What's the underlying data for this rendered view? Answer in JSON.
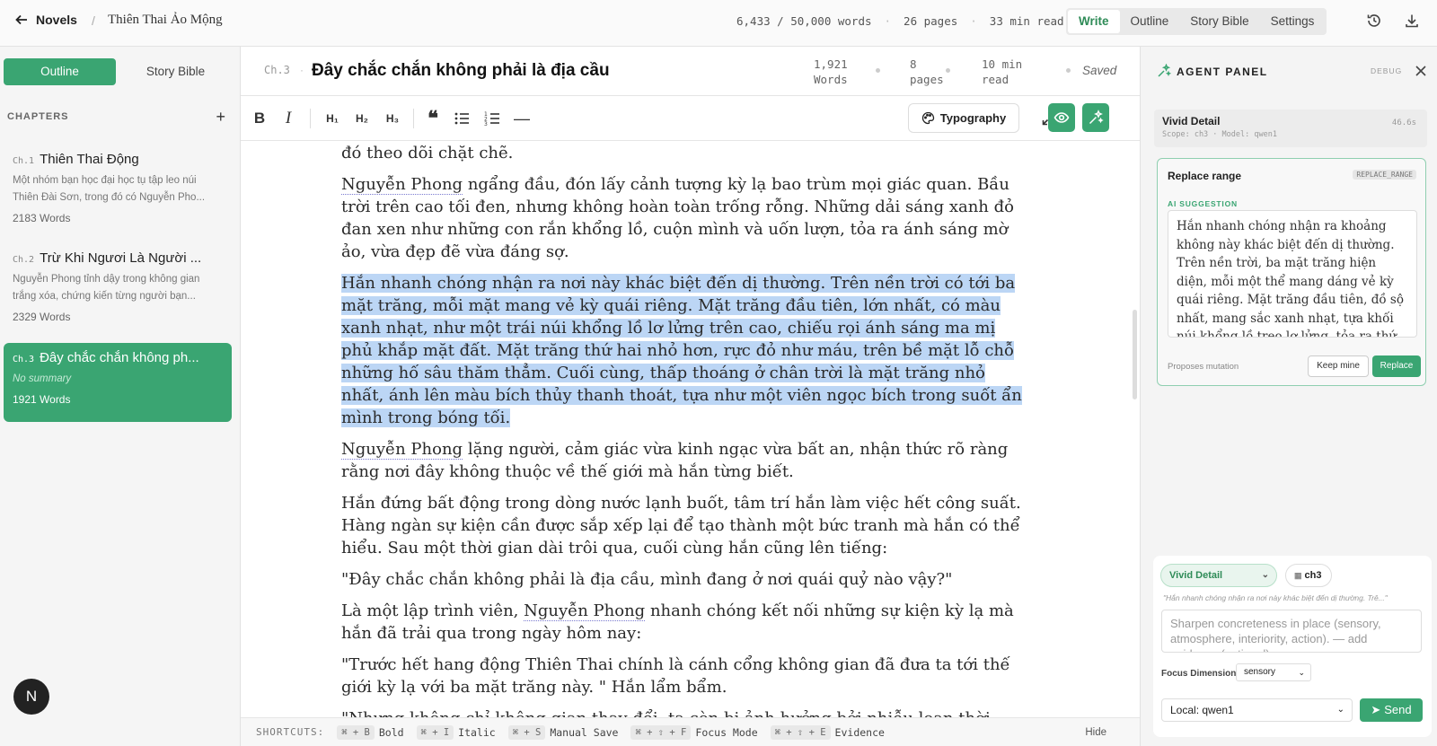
{
  "topbar": {
    "back_label": "Novels",
    "separator": "/",
    "book_title": "Thiên Thai Ảo Mộng",
    "word_progress": "6,433 / 50,000 words",
    "pages": "26 pages",
    "read_time": "33 min read",
    "modes": [
      "Write",
      "Outline",
      "Story Bible",
      "Settings"
    ],
    "active_mode": "Write"
  },
  "sidebar": {
    "tabs": [
      "Outline",
      "Story Bible"
    ],
    "active_tab": "Outline",
    "chapters_heading": "CHAPTERS",
    "chapters": [
      {
        "num": "Ch.1",
        "title": "Thiên Thai Động",
        "summary": "Một nhóm bạn học đại học tụ tập leo núi Thiên Đài Sơn, trong đó có Nguyễn Pho...",
        "words": "2183 Words"
      },
      {
        "num": "Ch.2",
        "title": "Trừ Khi Ngươi Là Người ...",
        "summary": "Nguyễn Phong tỉnh dậy trong không gian trắng xóa, chứng kiến từng người bạn...",
        "words": "2329 Words"
      },
      {
        "num": "Ch.3",
        "title": "Đây chắc chắn không ph...",
        "summary": "No summary",
        "words": "1921 Words"
      }
    ],
    "avatar_letter": "N"
  },
  "editor": {
    "chapter_num": "Ch.3",
    "chapter_title": "Đây chắc chắn không phải là địa cầu",
    "stat_words": [
      "1,921",
      "Words"
    ],
    "stat_pages": [
      "8",
      "pages"
    ],
    "stat_read": [
      "10 min",
      "read"
    ],
    "saved": "Saved",
    "typography_label": "Typography",
    "paragraphs": {
      "p0": "Mọi thứ diễn ra quá nhanh, hắn không thể hiểu nổi, chỉ biết rằng mình đang bị ai đó theo dõi chặt chẽ.",
      "p1_name": "Nguyễn Phong",
      "p1_rest": " ngẩng đầu, đón lấy cảnh tượng kỳ lạ bao trùm mọi giác quan. Bầu trời trên cao tối đen, nhưng không hoàn toàn trống rỗng. Những dải sáng xanh đỏ đan xen như những con rắn khổng lồ, cuộn mình và uốn lượn, tỏa ra ánh sáng mờ ảo, vừa đẹp đẽ vừa đáng sợ.",
      "p2": "Hắn nhanh chóng nhận ra nơi này khác biệt đến dị thường. Trên nền trời có tới ba mặt trăng, mỗi mặt mang vẻ kỳ quái riêng. Mặt trăng đầu tiên, lớn nhất, có màu xanh nhạt, như một trái núi khổng lồ lơ lửng trên cao, chiếu rọi ánh sáng ma mị phủ khắp mặt đất. Mặt trăng thứ hai nhỏ hơn, rực đỏ như máu, trên bề mặt lỗ chỗ những hố sâu thăm thẳm. Cuối cùng, thấp thoáng ở chân trời là mặt trăng nhỏ nhất, ánh lên màu bích thủy thanh thoát, tựa như một viên ngọc bích trong suốt ẩn mình trong bóng tối.",
      "p3_name": "Nguyễn Phong",
      "p3_rest": " lặng người, cảm giác vừa kinh ngạc vừa bất an, nhận thức rõ ràng rằng nơi đây không thuộc về thế giới mà hắn từng biết.",
      "p4": "Hắn đứng bất động trong dòng nước lạnh buốt, tâm trí hắn làm việc hết công suất. Hàng ngàn sự kiện cần được sắp xếp lại để tạo thành một bức tranh mà hắn có thể hiểu. Sau một thời gian dài trôi qua, cuối cùng hắn cũng lên tiếng:",
      "p5": "\"Đây chắc chắn không phải là địa cầu, mình đang ở nơi quái quỷ nào vậy?\"",
      "p6_pre": "Là một lập trình viên, ",
      "p6_name": "Nguyễn Phong",
      "p6_rest": " nhanh chóng kết nối những sự kiện kỳ lạ mà hắn đã trải qua trong ngày hôm nay:",
      "p7": "\"Trước hết hang động Thiên Thai chính là cánh cổng không gian đã đưa ta tới thế giới kỳ lạ với ba mặt trăng này. \" Hắn lẩm bẩm.",
      "p8": "\"Nhưng không chỉ không gian thay đổi, ta còn bị ảnh hưởng bởi nhiễu loạn thời gian, khiến"
    }
  },
  "footer": {
    "label": "SHORTCUTS:",
    "shortcuts": [
      {
        "keys": "⌘ + B",
        "action": "Bold"
      },
      {
        "keys": "⌘ + I",
        "action": "Italic"
      },
      {
        "keys": "⌘ + S",
        "action": "Manual Save"
      },
      {
        "keys": "⌘ + ⇧ + F",
        "action": "Focus Mode"
      },
      {
        "keys": "⌘ + ⇧ + E",
        "action": "Evidence"
      }
    ],
    "hide": "Hide"
  },
  "agent": {
    "title": "AGENT PANEL",
    "debug": "DEBUG",
    "run": {
      "name": "Vivid Detail",
      "scope": "Scope: ch3 · Model: qwen1",
      "time": "46.6s"
    },
    "suggestion": {
      "title": "Replace range",
      "tag": "REPLACE_RANGE",
      "label": "AI SUGGESTION",
      "text": "Hắn nhanh chóng nhận ra khoảng không này khác biệt đến dị thường. Trên nền trời, ba mặt trăng hiện diện, mỗi một thể mang dáng vẻ kỳ quái riêng. Mặt trăng đầu tiên, đồ sộ nhất, mang sắc xanh nhạt, tựa khối núi khổng lồ treo lơ lửng, tỏa ra thứ ánh sáng lạnh lẽo, rợn rợn trải dài",
      "proposes": "Proposes mutation",
      "keep": "Keep mine",
      "replace": "Replace"
    },
    "composer": {
      "mode": "Vivid Detail",
      "chip": "ch3",
      "quote": "\"Hắn nhanh chóng nhận ra nơi này khác biệt đến dị thường. Trê...\"",
      "placeholder": "Sharpen concreteness in place (sensory, atmosphere, interiority, action). — add guidance (optional)",
      "focus_label": "Focus Dimension",
      "focus_value": "sensory",
      "model": "Local: qwen1",
      "send": "Send"
    }
  },
  "colors": {
    "accent": "#3aa572",
    "highlight": "#bcd6f5"
  }
}
